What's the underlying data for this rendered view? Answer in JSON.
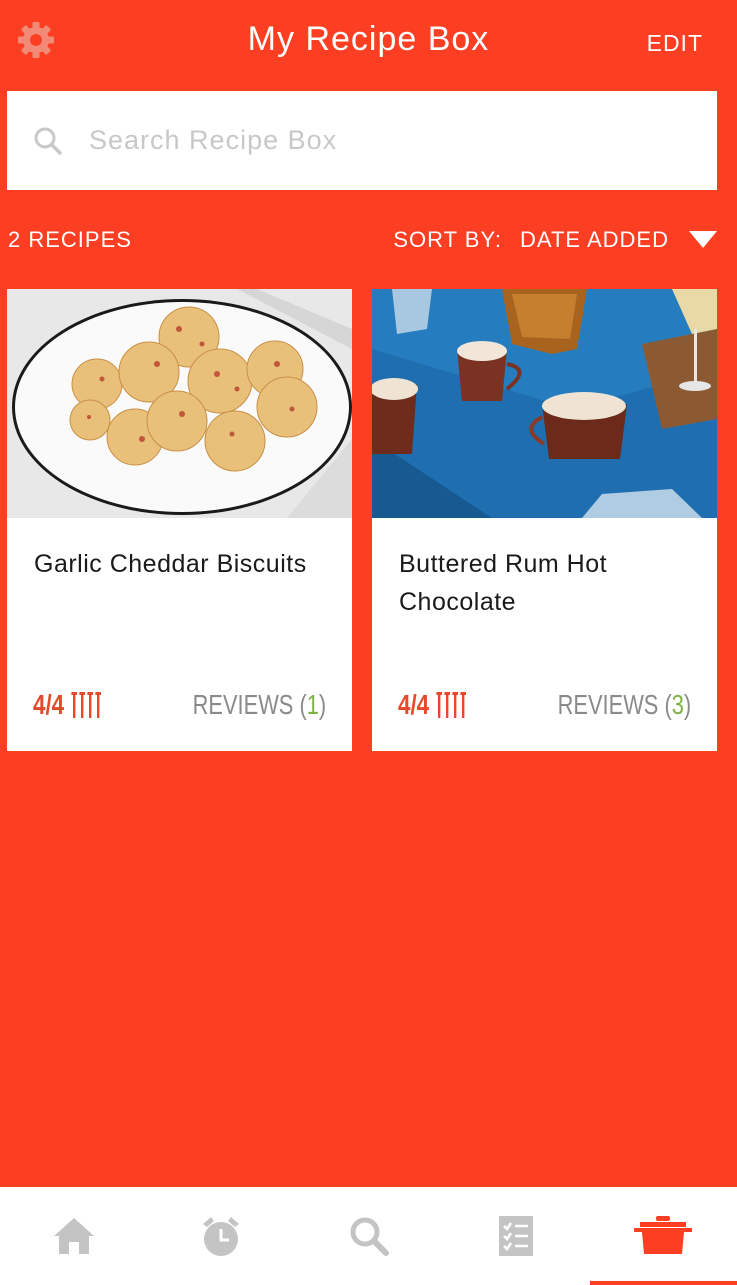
{
  "header": {
    "title": "My Recipe Box",
    "edit_label": "EDIT"
  },
  "search": {
    "placeholder": "Search Recipe Box"
  },
  "toolbar": {
    "count_label": "2 RECIPES",
    "sort_label": "SORT BY:",
    "sort_value": "DATE ADDED"
  },
  "recipes": [
    {
      "name": "Garlic Cheddar Biscuits",
      "rating": "4/4",
      "reviews_label": "REVIEWS (",
      "reviews_count": "1",
      "reviews_close": ")"
    },
    {
      "name": "Buttered Rum Hot Chocolate",
      "rating": "4/4",
      "reviews_label": "REVIEWS (",
      "reviews_count": "3",
      "reviews_close": ")"
    }
  ],
  "tabs": [
    {
      "icon": "home-icon"
    },
    {
      "icon": "timer-icon"
    },
    {
      "icon": "search-icon"
    },
    {
      "icon": "shopping-list-icon"
    },
    {
      "icon": "pot-icon",
      "active": true
    }
  ],
  "colors": {
    "accent": "#fc3f22",
    "rating": "#e44a2a",
    "review_count": "#7cb342",
    "tab_icon": "#c4c4c4"
  }
}
